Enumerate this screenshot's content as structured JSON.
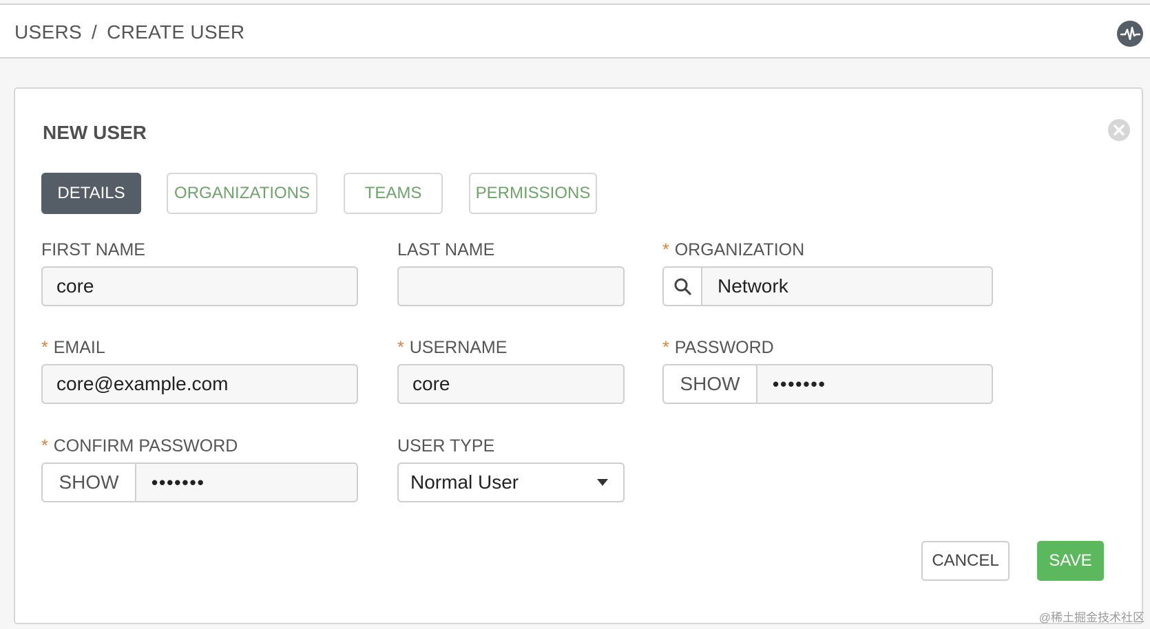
{
  "breadcrumb": {
    "parent": "USERS",
    "separator": "/",
    "current": "CREATE USER"
  },
  "header_icon": "activity-icon",
  "panel": {
    "title": "NEW USER",
    "close_icon": "close-icon"
  },
  "tabs": [
    {
      "label": "DETAILS",
      "active": true
    },
    {
      "label": "ORGANIZATIONS",
      "active": false
    },
    {
      "label": "TEAMS",
      "active": false
    },
    {
      "label": "PERMISSIONS",
      "active": false
    }
  ],
  "required_marker": "*",
  "form": {
    "first_name": {
      "label": "FIRST NAME",
      "value": "core"
    },
    "last_name": {
      "label": "LAST NAME",
      "value": ""
    },
    "organization": {
      "label": "ORGANIZATION",
      "value": "Network",
      "icon": "search-icon"
    },
    "email": {
      "label": "EMAIL",
      "value": "core@example.com"
    },
    "username": {
      "label": "USERNAME",
      "value": "core"
    },
    "password": {
      "label": "PASSWORD",
      "toggle": "SHOW",
      "masked": "•••••••"
    },
    "confirm_password": {
      "label": "CONFIRM PASSWORD",
      "toggle": "SHOW",
      "masked": "•••••••"
    },
    "user_type": {
      "label": "USER TYPE",
      "value": "Normal User"
    }
  },
  "actions": {
    "cancel": "CANCEL",
    "save": "SAVE"
  },
  "watermark": "@稀土掘金技术社区",
  "colors": {
    "accent_green": "#5cb85c",
    "tab_green_text": "#6fa36b",
    "active_tab_bg": "#555d66",
    "required_orange": "#d9823b"
  }
}
